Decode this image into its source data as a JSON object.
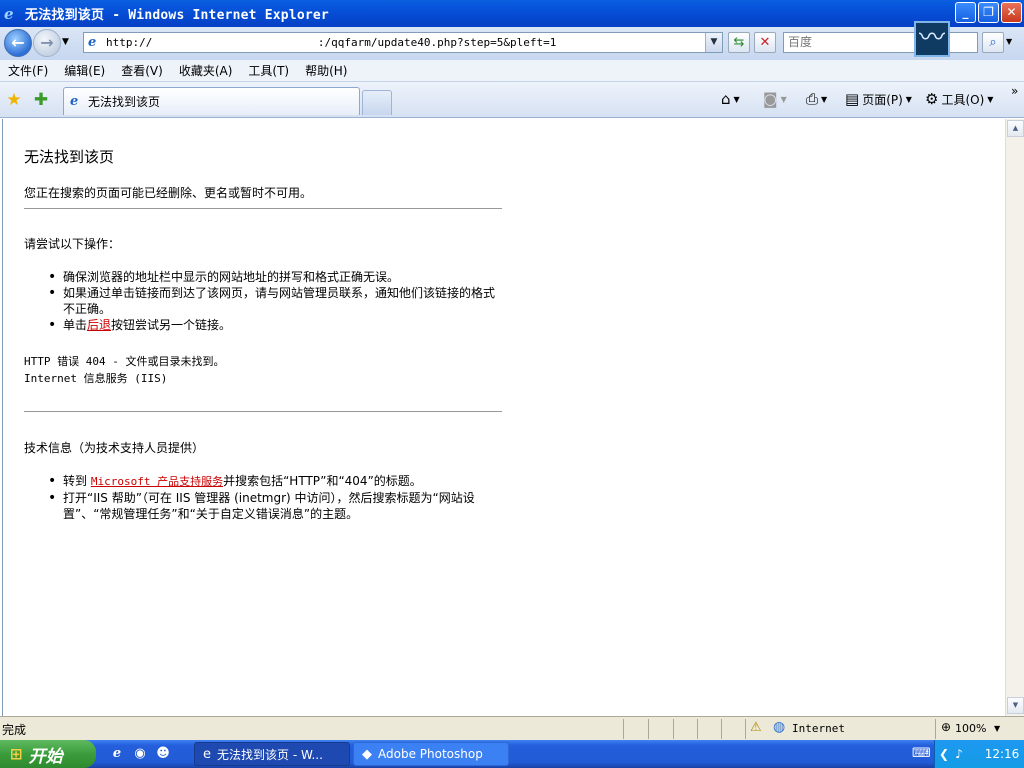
{
  "window": {
    "title": "无法找到该页 - Windows Internet Explorer",
    "min_glyph": "_",
    "max_glyph": "❐",
    "close_glyph": "✕"
  },
  "address_bar": {
    "url": "http://                         :/qqfarm/update40.php?step=5&pleft=1",
    "search_placeholder": "百度"
  },
  "menu": [
    "文件(F)",
    "编辑(E)",
    "查看(V)",
    "收藏夹(A)",
    "工具(T)",
    "帮助(H)"
  ],
  "tab": {
    "label": "无法找到该页"
  },
  "command_bar": {
    "page_label": "页面(P)",
    "tools_label": "工具(O)",
    "chevron": "»"
  },
  "page": {
    "title": "无法找到该页",
    "intro": "您正在搜索的页面可能已经删除、更名或暂时不可用。",
    "try_heading": "请尝试以下操作：",
    "try_items": [
      "确保浏览器的地址栏中显示的网站地址的拼写和格式正确无误。",
      "如果通过单击链接而到达了该网页，请与网站管理员联系，通知他们该链接的格式不正确。"
    ],
    "back_prefix": "单击",
    "back_link": "后退",
    "back_suffix": "按钮尝试另一个链接。",
    "error_line": "HTTP 错误 404 - 文件或目录未找到。",
    "server_line": "Internet 信息服务 (IIS)",
    "tech_heading": "技术信息（为技术支持人员提供）",
    "tech_item1_prefix": "转到",
    "tech_item1_link": "Microsoft 产品支持服务",
    "tech_item1_suffix": "并搜索包括“HTTP”和“404”的标题。",
    "tech_item2": "打开“IIS 帮助”（可在 IIS 管理器 (inetmgr) 中访问），然后搜索标题为“网站设置”、“常规管理任务”和“关于自定义错误消息”的主题。"
  },
  "status_bar": {
    "status": "完成",
    "zone": "Internet",
    "zoom": "100%"
  },
  "taskbar": {
    "start_label": "开始",
    "tasks": [
      {
        "label": "无法找到该页 - W...",
        "active": true
      },
      {
        "label": "Adobe Photoshop",
        "active": false
      }
    ],
    "clock": "12:16"
  }
}
